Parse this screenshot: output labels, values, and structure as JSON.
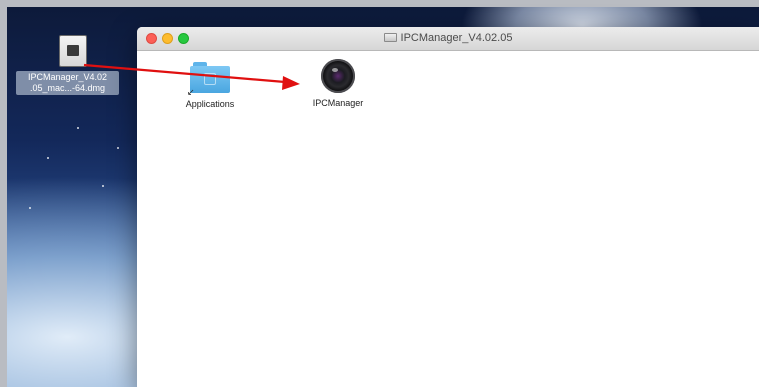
{
  "desktop": {
    "dmg_file": {
      "label_line1": "IPCManager_V4.02",
      "label_line2": ".05_mac...-64.dmg",
      "icon": "disk-image-icon"
    }
  },
  "window": {
    "title": "IPCManager_V4.02.05",
    "title_icon": "disk-icon",
    "traffic_lights": [
      "close",
      "minimize",
      "maximize"
    ],
    "items": [
      {
        "label": "Applications",
        "icon": "folder-alias-icon"
      },
      {
        "label": "IPCManager",
        "icon": "camera-lens-icon"
      }
    ]
  },
  "annotation": {
    "arrow_color": "#e01010",
    "meaning": ""
  },
  "colors": {
    "close": "#fc5f57",
    "minimize": "#fdbc2e",
    "maximize": "#27c840",
    "folder": "#5eb4ea"
  }
}
